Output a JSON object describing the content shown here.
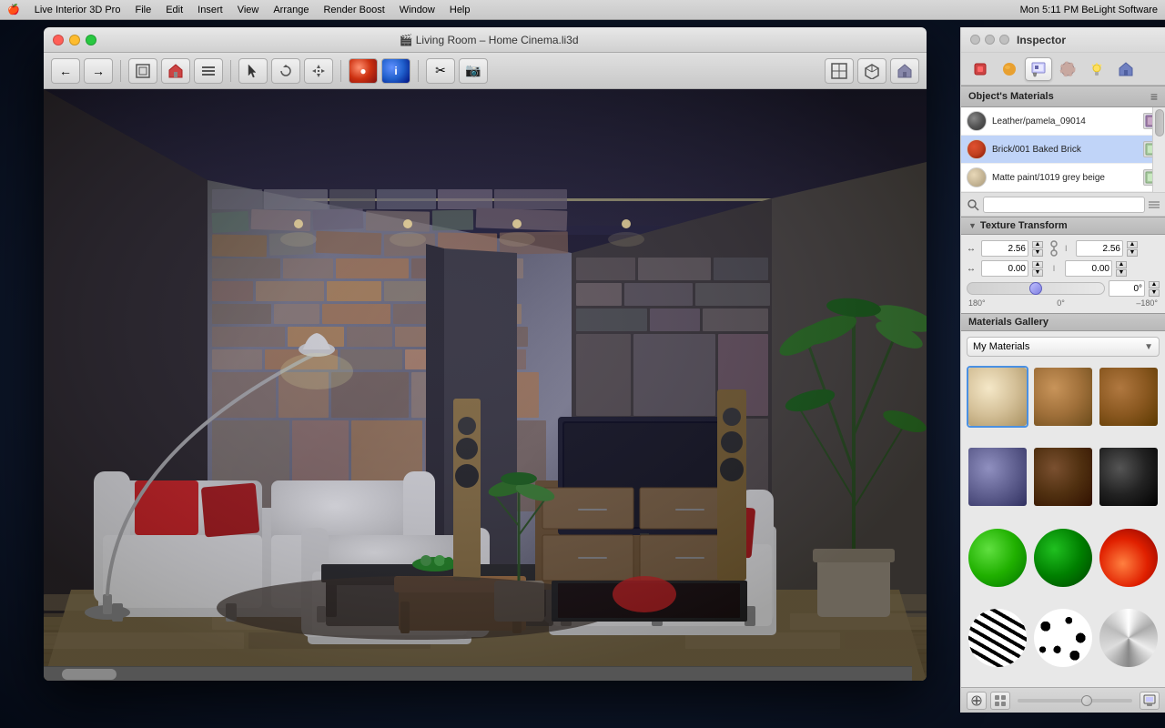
{
  "menubar": {
    "apple": "🍎",
    "items": [
      "Live Interior 3D Pro",
      "File",
      "Edit",
      "Insert",
      "View",
      "Arrange",
      "Render Boost",
      "Window",
      "Help"
    ],
    "right": "Mon 5:11 PM  BeLight Software"
  },
  "window": {
    "title": "🎬 Living Room – Home Cinema.li3d",
    "traffic": [
      "close",
      "minimize",
      "maximize"
    ]
  },
  "toolbar": {
    "nav_back": "←",
    "nav_fwd": "→",
    "tools": [
      "⊞",
      "🏠",
      "≡",
      "↗",
      "⊙",
      "⊕",
      "⊗",
      "✂",
      "📷"
    ]
  },
  "inspector": {
    "title": "Inspector",
    "tabs": [
      {
        "id": "object",
        "icon": "🏷",
        "active": false
      },
      {
        "id": "material-ball",
        "icon": "●",
        "active": false
      },
      {
        "id": "paint",
        "icon": "✏",
        "active": true
      },
      {
        "id": "texture",
        "icon": "◉",
        "active": false
      },
      {
        "id": "bulb",
        "icon": "💡",
        "active": false
      },
      {
        "id": "house",
        "icon": "🏠",
        "active": false
      }
    ],
    "objects_materials_title": "Object's Materials",
    "materials": [
      {
        "name": "Leather/pamela_09014",
        "swatch_class": "mat-leather",
        "selected": false
      },
      {
        "name": "Brick/001 Baked Brick",
        "swatch_class": "mat-brick",
        "selected": true
      },
      {
        "name": "Matte paint/1019 grey beige",
        "swatch_class": "mat-matte-beige",
        "selected": false
      }
    ],
    "texture_transform": {
      "title": "Texture Transform",
      "scale_x_label": "↔",
      "scale_x_value": "2.56",
      "scale_y_label": "↕",
      "scale_y_value": "2.56",
      "offset_x_label": "↔",
      "offset_x_value": "0.00",
      "offset_y_label": "↕",
      "offset_y_value": "0.00",
      "rotation_min": "180°",
      "rotation_mid": "0°",
      "rotation_max": "–180°",
      "rotation_value": "0°"
    },
    "gallery": {
      "title": "Materials Gallery",
      "dropdown_value": "My Materials",
      "items": [
        {
          "id": "g1",
          "class": "swatch-beige",
          "selected": true
        },
        {
          "id": "g2",
          "class": "swatch-wood1",
          "selected": false
        },
        {
          "id": "g3",
          "class": "swatch-wood2",
          "selected": false
        },
        {
          "id": "g4",
          "class": "swatch-metal-blue",
          "selected": false
        },
        {
          "id": "g5",
          "class": "swatch-dark-wood",
          "selected": false
        },
        {
          "id": "g6",
          "class": "swatch-black",
          "selected": false
        },
        {
          "id": "g7",
          "class": "swatch-green-bright",
          "selected": false
        },
        {
          "id": "g8",
          "class": "swatch-green-dark",
          "selected": false
        },
        {
          "id": "g9",
          "class": "swatch-fire",
          "selected": false
        },
        {
          "id": "g10",
          "class": "swatch-zebra",
          "selected": false
        },
        {
          "id": "g11",
          "class": "swatch-dalmatian",
          "selected": false
        },
        {
          "id": "g12",
          "class": "swatch-chrome",
          "selected": false
        }
      ]
    }
  }
}
